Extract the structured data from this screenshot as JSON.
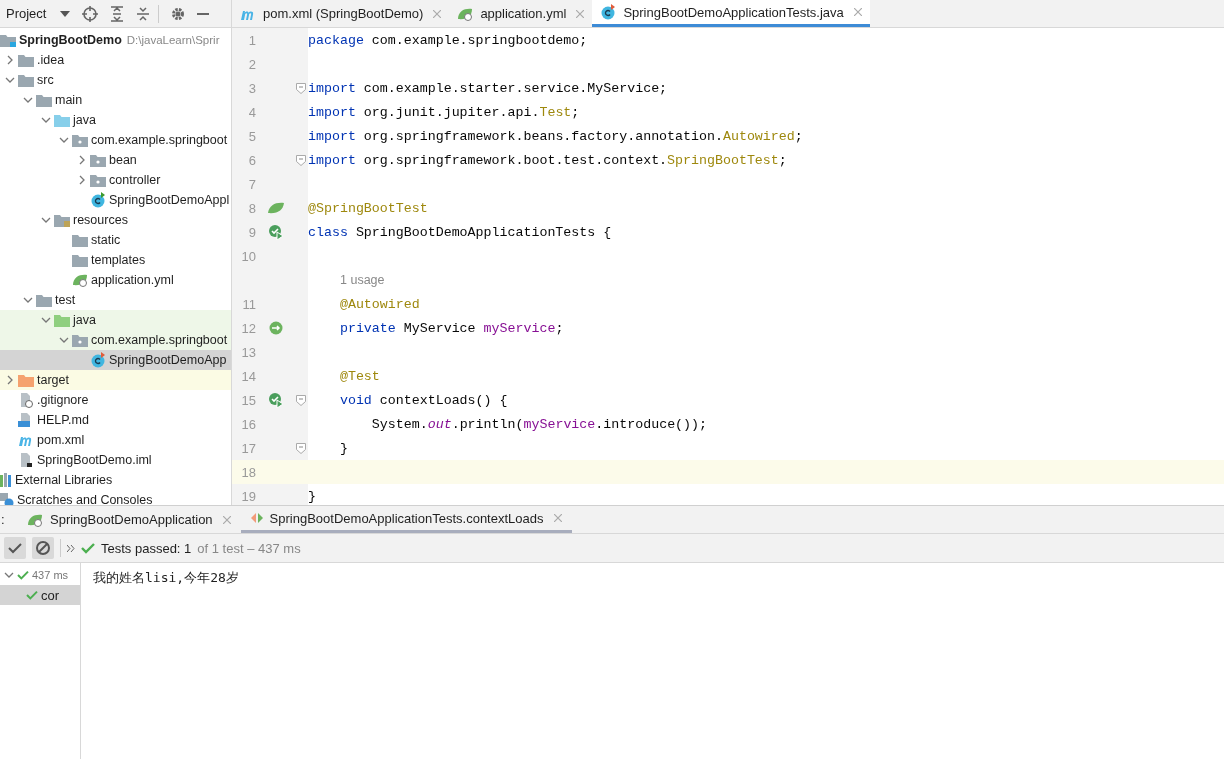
{
  "project_panel": {
    "title": "Project",
    "tree": [
      {
        "label": "SpringBootDemo",
        "path": "D:\\javaLearn\\Sprir",
        "kind": "module",
        "bold": true,
        "children": [
          {
            "label": ".idea",
            "kind": "folder",
            "expanded": false
          },
          {
            "label": "src",
            "kind": "folder",
            "expanded": true,
            "children": [
              {
                "label": "main",
                "kind": "folder",
                "expanded": true,
                "children": [
                  {
                    "label": "java",
                    "kind": "source",
                    "expanded": true,
                    "children": [
                      {
                        "label": "com.example.springboot",
                        "kind": "package",
                        "expanded": true,
                        "children": [
                          {
                            "label": "bean",
                            "kind": "package",
                            "expanded": false
                          },
                          {
                            "label": "controller",
                            "kind": "package",
                            "expanded": false
                          },
                          {
                            "label": "SpringBootDemoAppl",
                            "kind": "spring-class"
                          }
                        ]
                      }
                    ]
                  },
                  {
                    "label": "resources",
                    "kind": "resources",
                    "expanded": true,
                    "children": [
                      {
                        "label": "static",
                        "kind": "folder"
                      },
                      {
                        "label": "templates",
                        "kind": "folder"
                      },
                      {
                        "label": "application.yml",
                        "kind": "yml"
                      }
                    ]
                  }
                ]
              },
              {
                "label": "test",
                "kind": "folder",
                "expanded": true,
                "children": [
                  {
                    "label": "java",
                    "kind": "test",
                    "expanded": true,
                    "color": "#eef7e8",
                    "children": [
                      {
                        "label": "com.example.springboot",
                        "kind": "package",
                        "expanded": true,
                        "color": "#eef7e8",
                        "children": [
                          {
                            "label": "SpringBootDemoApp",
                            "kind": "class",
                            "selected": true
                          }
                        ]
                      }
                    ]
                  }
                ]
              }
            ]
          },
          {
            "label": "target",
            "kind": "excluded",
            "expanded": false,
            "color": "#fbfbe4"
          },
          {
            "label": ".gitignore",
            "kind": "ignore"
          },
          {
            "label": "HELP.md",
            "kind": "md"
          },
          {
            "label": "pom.xml",
            "kind": "maven"
          },
          {
            "label": "SpringBootDemo.iml",
            "kind": "iml"
          }
        ]
      },
      {
        "label": "External Libraries",
        "kind": "libraries"
      },
      {
        "label": "Scratches and Consoles",
        "kind": "scratches"
      }
    ]
  },
  "editor_tabs": [
    {
      "label": "pom.xml (SpringBootDemo)",
      "kind": "maven",
      "selected": false
    },
    {
      "label": "application.yml",
      "kind": "yml",
      "selected": false
    },
    {
      "label": "SpringBootDemoApplicationTests.java",
      "kind": "class",
      "selected": true
    }
  ],
  "code_lines": [
    {
      "number": "1",
      "tokens": [
        {
          "kind": "keyword",
          "text": "package"
        },
        {
          "kind": "plain",
          "text": " com.example.springbootdemo;"
        }
      ]
    },
    {
      "number": "2"
    },
    {
      "number": "3",
      "fold": true,
      "tokens": [
        {
          "kind": "keyword",
          "text": "import"
        },
        {
          "kind": "plain",
          "text": " com.example.starter.service.MyService;"
        }
      ]
    },
    {
      "number": "4",
      "tokens": [
        {
          "kind": "keyword",
          "text": "import"
        },
        {
          "kind": "plain",
          "text": " org.junit.jupiter.api."
        },
        {
          "kind": "annotation",
          "text": "Test"
        },
        {
          "kind": "plain",
          "text": ";"
        }
      ]
    },
    {
      "number": "5",
      "tokens": [
        {
          "kind": "keyword",
          "text": "import"
        },
        {
          "kind": "plain",
          "text": " org.springframework.beans.factory.annotation."
        },
        {
          "kind": "annotation",
          "text": "Autowired"
        },
        {
          "kind": "plain",
          "text": ";"
        }
      ]
    },
    {
      "number": "6",
      "fold": true,
      "tokens": [
        {
          "kind": "keyword",
          "text": "import"
        },
        {
          "kind": "plain",
          "text": " org.springframework.boot.test.context."
        },
        {
          "kind": "annotation",
          "text": "SpringBootTest"
        },
        {
          "kind": "plain",
          "text": ";"
        }
      ]
    },
    {
      "number": "7"
    },
    {
      "number": "8",
      "kind": "spring",
      "tokens": [
        {
          "kind": "annotation",
          "text": "@SpringBootTest"
        }
      ]
    },
    {
      "number": "9",
      "kind": "run",
      "tokens": [
        {
          "kind": "keyword",
          "text": "class"
        },
        {
          "kind": "plain",
          "text": " SpringBootDemoApplicationTests {"
        }
      ]
    },
    {
      "number": "10"
    },
    {
      "hint": "1 usage"
    },
    {
      "number": "11",
      "tokens": [
        {
          "kind": "annotation",
          "text": "    @Autowired"
        }
      ]
    },
    {
      "number": "12",
      "kind": "bean",
      "tokens": [
        {
          "kind": "keyword",
          "text": "    private"
        },
        {
          "kind": "plain",
          "text": " MyService "
        },
        {
          "kind": "field",
          "text": "myService"
        },
        {
          "kind": "plain",
          "text": ";"
        }
      ]
    },
    {
      "number": "13"
    },
    {
      "number": "14",
      "tokens": [
        {
          "kind": "annotation",
          "text": "    @Test"
        }
      ]
    },
    {
      "number": "15",
      "kind": "run",
      "fold": true,
      "tokens": [
        {
          "kind": "keyword",
          "text": "    void"
        },
        {
          "kind": "plain",
          "text": " contextLoads() {"
        }
      ]
    },
    {
      "number": "16",
      "tokens": [
        {
          "kind": "plain",
          "text": "        System."
        },
        {
          "kind": "static",
          "text": "out"
        },
        {
          "kind": "plain",
          "text": ".println("
        },
        {
          "kind": "field",
          "text": "myService"
        },
        {
          "kind": "plain",
          "text": ".introduce());"
        }
      ]
    },
    {
      "number": "17",
      "fold": true,
      "tokens": [
        {
          "kind": "plain",
          "text": "    }"
        }
      ]
    },
    {
      "number": "18",
      "current": true
    },
    {
      "number": "19",
      "tokens": [
        {
          "kind": "plain",
          "text": "}"
        }
      ]
    }
  ],
  "run_panel": {
    "edge_mark": ":",
    "tabs": [
      {
        "label": "SpringBootDemoApplication",
        "kind": "spring",
        "selected": false
      },
      {
        "label": "SpringBootDemoApplicationTests.contextLoads",
        "kind": "test-run",
        "selected": true
      }
    ],
    "status_strong": "Tests passed: 1",
    "status_rest": "of 1 test – 437 ms",
    "results": [
      {
        "label": "437 ms",
        "expanded": true,
        "selected": false,
        "children": [
          {
            "label": "cor",
            "selected": true
          }
        ]
      }
    ],
    "output": "我的姓名lisi,今年28岁"
  }
}
